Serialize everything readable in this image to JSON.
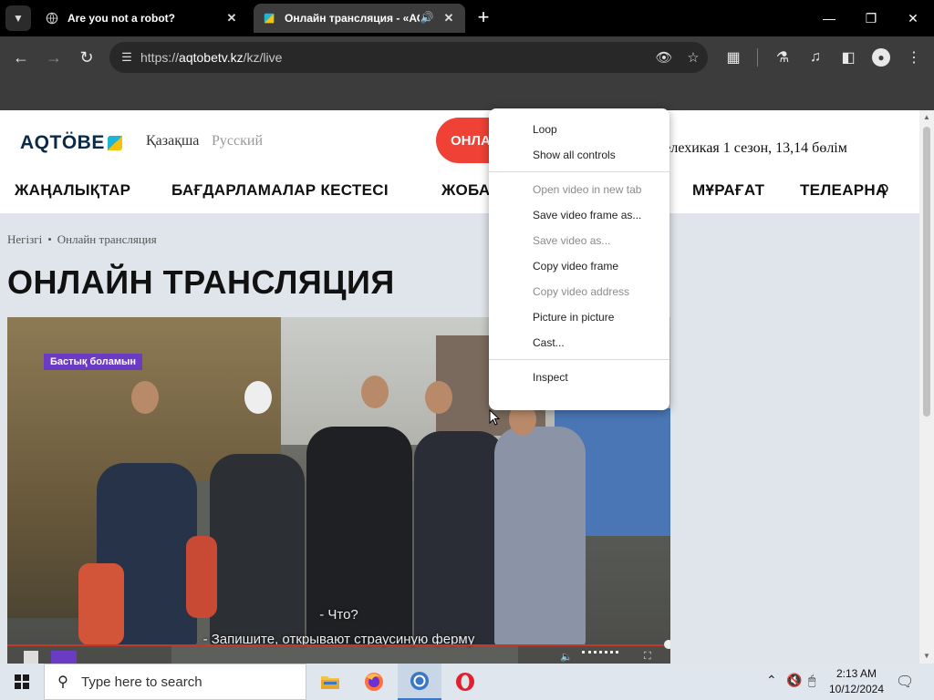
{
  "browser": {
    "tabs": [
      {
        "title": "Are you not a robot?",
        "active": false
      },
      {
        "title": "Онлайн трансляция - «АС",
        "active": true,
        "playing_audio": true
      }
    ],
    "address": {
      "scheme": "https://",
      "host": "aqtobetv.kz",
      "path": "/kz/live"
    }
  },
  "site": {
    "logo_text": "AQTÖBE",
    "languages": [
      "Қазақша",
      "Русский"
    ],
    "live_button": "ОНЛА",
    "now_playing": "н\" Телехикая 1 сезон, 13,14 бөлім",
    "nav": [
      "ЖАҢАЛЫҚТАР",
      "БАҒДАРЛАМАЛАР КЕСТЕСІ",
      "ЖОБА",
      "МҰРАҒАТ",
      "ТЕЛЕАРНА"
    ],
    "breadcrumb": [
      "Негізгі",
      "Онлайн трансляция"
    ],
    "page_title": "ОНЛАЙН ТРАНСЛЯЦИЯ"
  },
  "video": {
    "badge": "Бастық боламын",
    "subtitle_lines": [
      "- Что?",
      "- Запишите, открывают страусиную ферму"
    ],
    "progress_fraction": 0.99
  },
  "context_menu": {
    "group1": [
      {
        "label": "Loop",
        "enabled": true
      },
      {
        "label": "Show all controls",
        "enabled": true
      }
    ],
    "group2": [
      {
        "label": "Open video in new tab",
        "enabled": false
      },
      {
        "label": "Save video frame as...",
        "enabled": true
      },
      {
        "label": "Save video as...",
        "enabled": false
      },
      {
        "label": "Copy video frame",
        "enabled": true
      },
      {
        "label": "Copy video address",
        "enabled": false
      },
      {
        "label": "Picture in picture",
        "enabled": true
      },
      {
        "label": "Cast...",
        "enabled": true
      }
    ],
    "group3": [
      {
        "label": "Inspect",
        "enabled": true
      }
    ]
  },
  "taskbar": {
    "search_placeholder": "Type here to search",
    "time": "2:13 AM",
    "date": "10/12/2024"
  },
  "colors": {
    "accent_live": "#ef4135",
    "badge": "#6c3bc4",
    "progress": "#c0392b"
  }
}
